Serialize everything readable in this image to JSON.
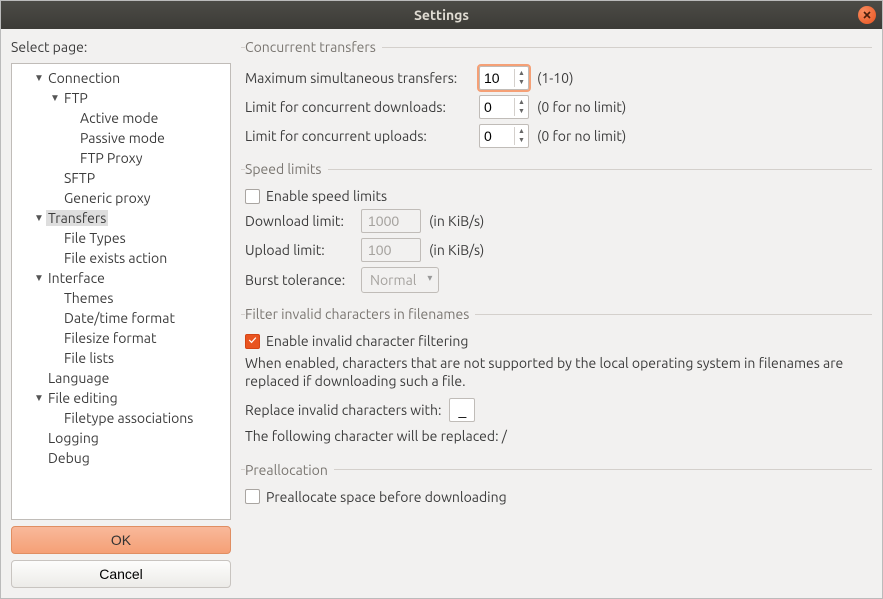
{
  "title": "Settings",
  "left": {
    "header": "Select page:",
    "tree": [
      {
        "label": "Connection",
        "expand": true,
        "level": 1
      },
      {
        "label": "FTP",
        "expand": true,
        "level": 2
      },
      {
        "label": "Active mode",
        "level": 3
      },
      {
        "label": "Passive mode",
        "level": 3
      },
      {
        "label": "FTP Proxy",
        "level": 3
      },
      {
        "label": "SFTP",
        "level": 2
      },
      {
        "label": "Generic proxy",
        "level": 2
      },
      {
        "label": "Transfers",
        "expand": true,
        "level": 1,
        "selected": true
      },
      {
        "label": "File Types",
        "level": 2
      },
      {
        "label": "File exists action",
        "level": 2
      },
      {
        "label": "Interface",
        "expand": true,
        "level": 1
      },
      {
        "label": "Themes",
        "level": 2
      },
      {
        "label": "Date/time format",
        "level": 2
      },
      {
        "label": "Filesize format",
        "level": 2
      },
      {
        "label": "File lists",
        "level": 2
      },
      {
        "label": "Language",
        "level": 1
      },
      {
        "label": "File editing",
        "expand": true,
        "level": 1
      },
      {
        "label": "Filetype associations",
        "level": 2
      },
      {
        "label": "Logging",
        "level": 1
      },
      {
        "label": "Debug",
        "level": 1
      }
    ],
    "ok": "OK",
    "cancel": "Cancel"
  },
  "concurrent": {
    "legend": "Concurrent transfers",
    "maxLabel": "Maximum simultaneous transfers:",
    "maxValue": "10",
    "maxHint": "(1-10)",
    "dlLabel": "Limit for concurrent downloads:",
    "dlValue": "0",
    "dlHint": "(0 for no limit)",
    "ulLabel": "Limit for concurrent uploads:",
    "ulValue": "0",
    "ulHint": "(0 for no limit)"
  },
  "speed": {
    "legend": "Speed limits",
    "enable": "Enable speed limits",
    "dlLabel": "Download limit:",
    "dlValue": "1000",
    "ulLabel": "Upload limit:",
    "ulValue": "100",
    "unit": "(in KiB/s)",
    "burstLabel": "Burst tolerance:",
    "burstValue": "Normal"
  },
  "filter": {
    "legend": "Filter invalid characters in filenames",
    "enable": "Enable invalid character filtering",
    "desc": "When enabled, characters that are not supported by the local operating system in filenames are replaced if downloading such a file.",
    "replaceLabel": "Replace invalid characters with:",
    "replaceValue": "_",
    "following": "The following character will be replaced: /"
  },
  "prealloc": {
    "legend": "Preallocation",
    "enable": "Preallocate space before downloading"
  }
}
